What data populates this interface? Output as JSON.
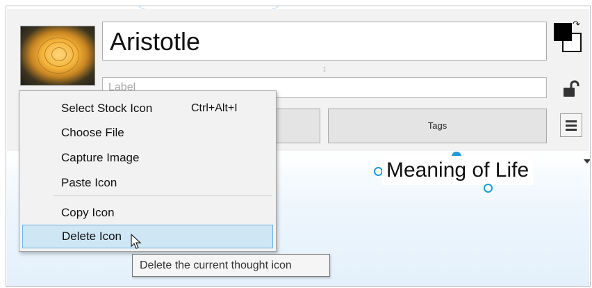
{
  "thought": {
    "name": "Aristotle",
    "label_value": "",
    "label_placeholder": "Label",
    "image_icon": "rose-image"
  },
  "buttons": {
    "tags_label": "Tags",
    "color_swap_icon": "swap-colors-icon",
    "lock_icon": "unlocked-padlock-icon",
    "menu_icon": "hamburger-menu-icon"
  },
  "canvas": {
    "node_label": "Meaning of Life"
  },
  "context_menu": {
    "items": [
      {
        "label": "Select Stock Icon",
        "shortcut": "Ctrl+Alt+I"
      },
      {
        "label": "Choose File",
        "shortcut": ""
      },
      {
        "label": "Capture Image",
        "shortcut": ""
      },
      {
        "label": "Paste Icon",
        "shortcut": ""
      },
      {
        "label": "Copy Icon",
        "shortcut": ""
      },
      {
        "label": "Delete Icon",
        "shortcut": ""
      }
    ],
    "hovered_item": "Delete Icon"
  },
  "tooltip": {
    "text": "Delete the current thought icon"
  },
  "colors": {
    "accent": "#1e9ad6",
    "menu_highlight": "#cfe6f5",
    "menu_highlight_border": "#6fb2e0"
  }
}
